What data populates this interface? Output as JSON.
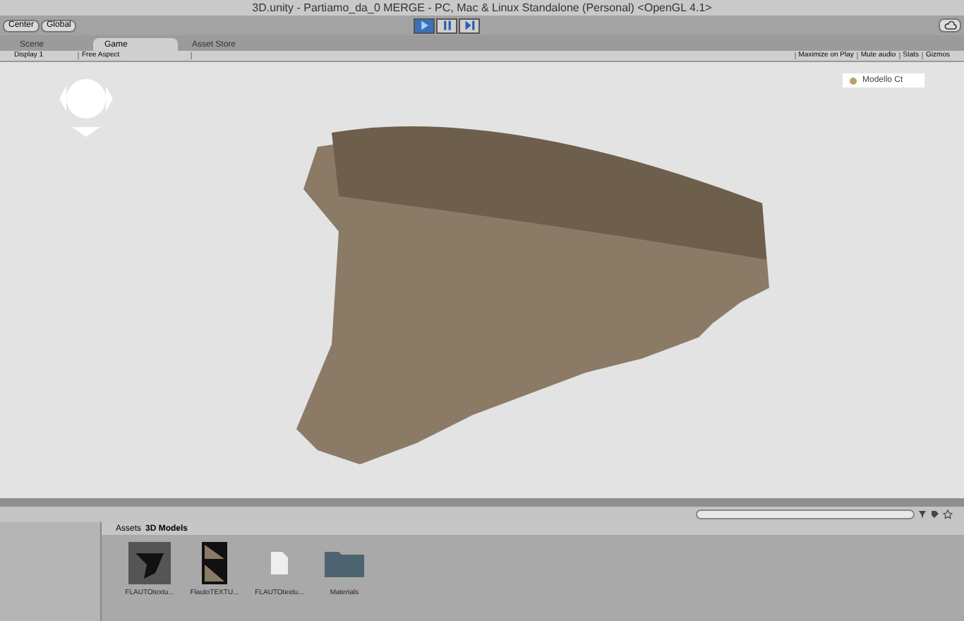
{
  "window": {
    "title": "3D.unity - Partiamo_da_0  MERGE - PC, Mac & Linux Standalone (Personal) <OpenGL 4.1>"
  },
  "toolbar": {
    "pivot_buttons": [
      "Center",
      "Global"
    ],
    "play_controls": [
      {
        "kind": "play",
        "selected": true
      },
      {
        "kind": "pause",
        "selected": false
      },
      {
        "kind": "step",
        "selected": false
      }
    ]
  },
  "tabs": [
    {
      "label": "Scene",
      "selected": false
    },
    {
      "label": "Game",
      "selected": true
    },
    {
      "label": "Asset Store",
      "selected": false
    }
  ],
  "game_toolbar": {
    "display": "Display 1",
    "aspect": "Free Aspect",
    "toggles": [
      "Maximize on Play",
      "Mute audio",
      "Stats",
      "Gizmos"
    ]
  },
  "game_view": {
    "legend": [
      {
        "label": "Modello Ct",
        "color": "#b8a26a"
      }
    ]
  },
  "project": {
    "breadcrumb": [
      "Assets",
      "3D Models"
    ],
    "assets": [
      {
        "kind": "model",
        "label": "FLAUTOtextu..."
      },
      {
        "kind": "texture",
        "label": "FlautoTEXTU..."
      },
      {
        "kind": "file",
        "label": "FLAUTOtextu..."
      },
      {
        "kind": "folder",
        "label": "Materials"
      }
    ]
  }
}
